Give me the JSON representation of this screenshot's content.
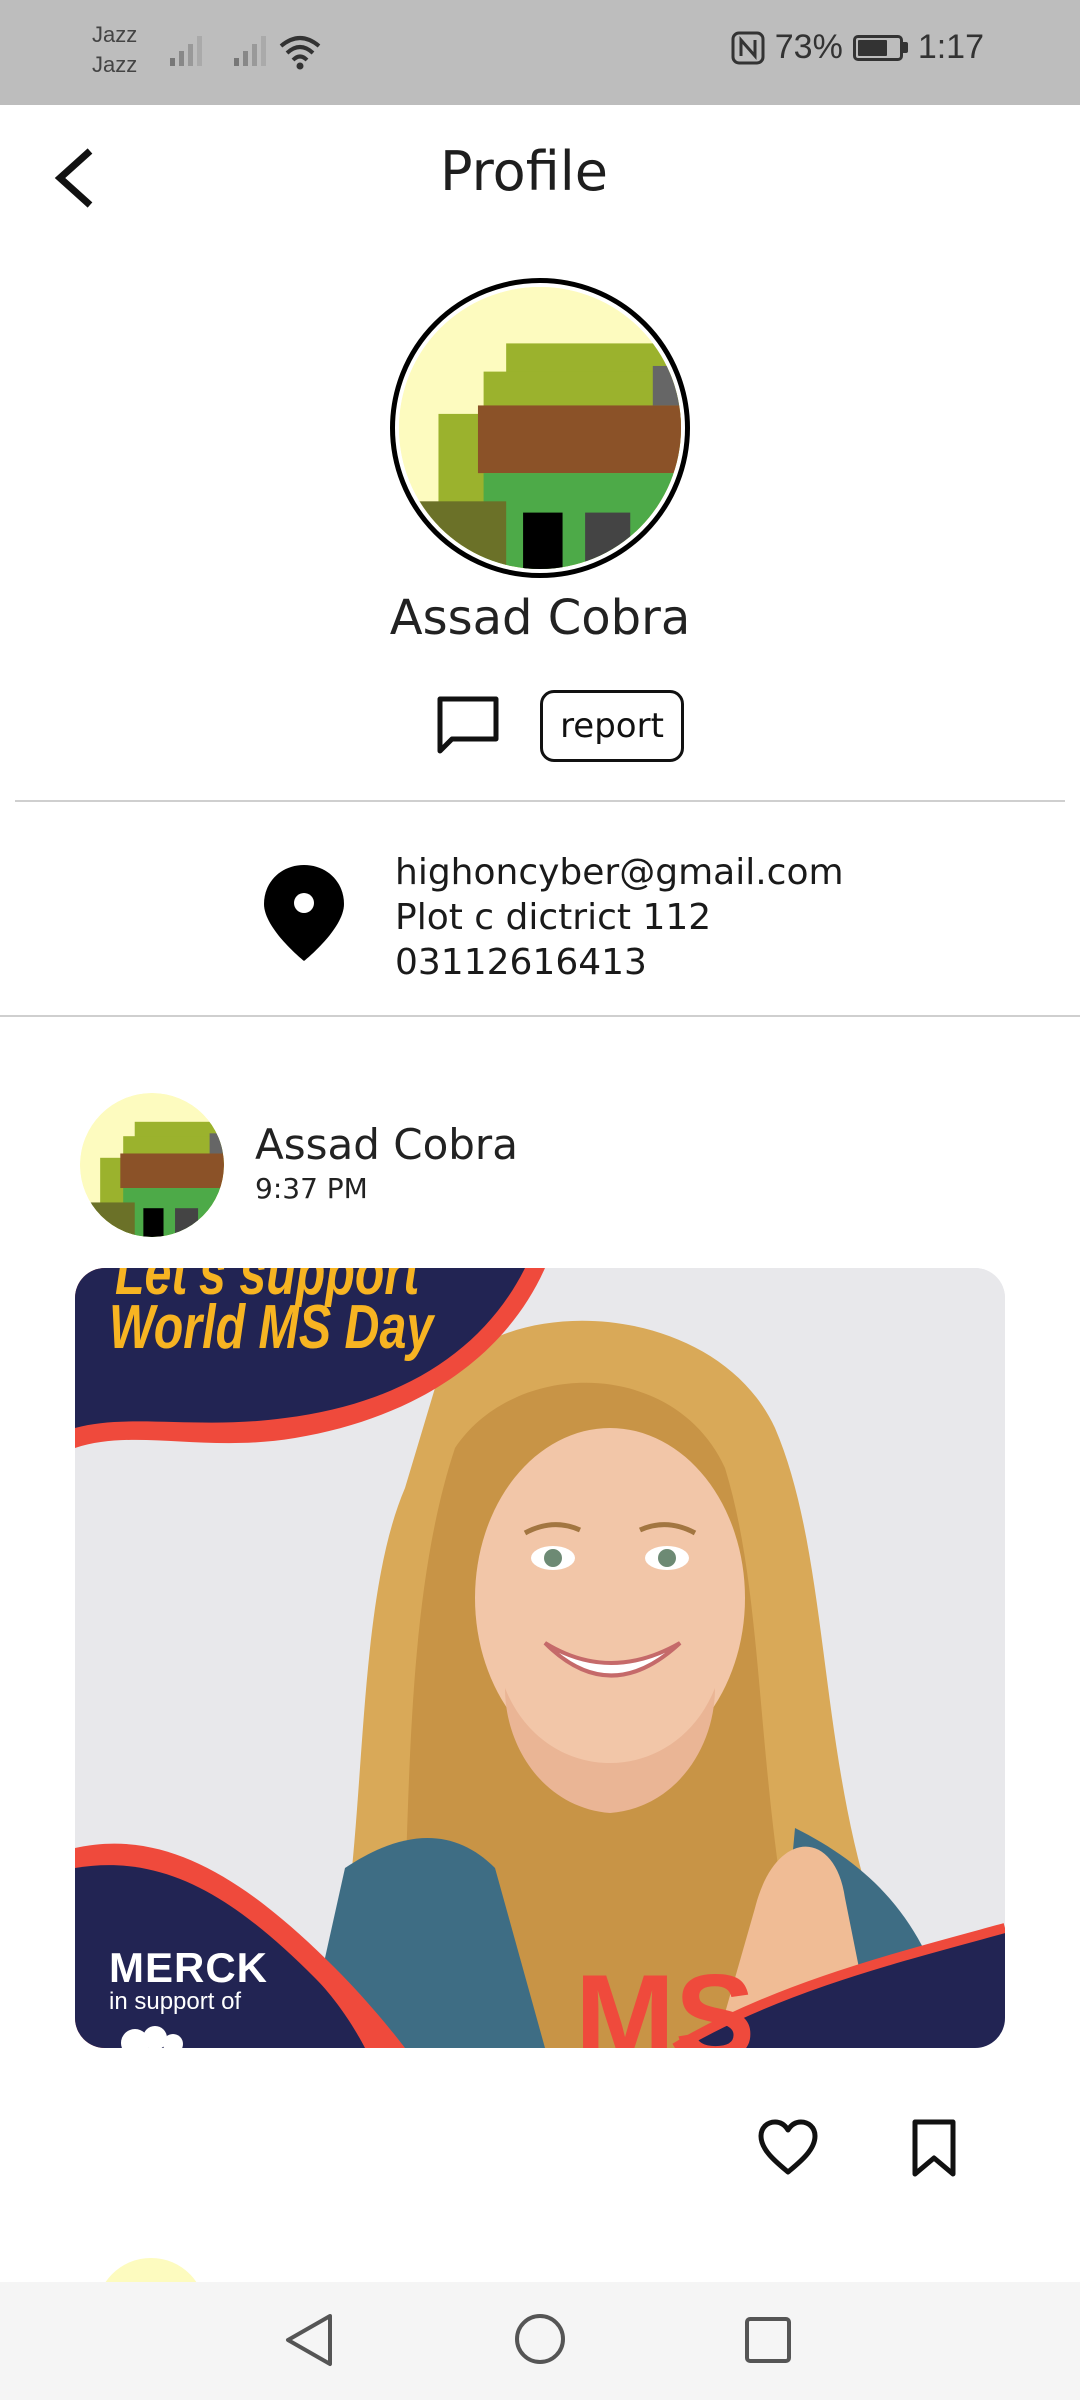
{
  "status_bar": {
    "carrier_1": "Jazz",
    "carrier_2": "Jazz",
    "battery_percent": "73%",
    "battery_level": 0.73,
    "time": "1:17",
    "icons": [
      "signal-icon",
      "signal-icon",
      "wifi-icon",
      "nfc-icon",
      "battery-icon"
    ]
  },
  "header": {
    "title": "Profile",
    "back_icon": "chevron-left-icon"
  },
  "profile": {
    "name": "Assad Cobra",
    "message_icon": "chat-bubble-icon",
    "report_label": "report",
    "contact": {
      "icon": "location-pin-icon",
      "email": "highoncyber@gmail.com",
      "address": "Plot c dictrict 112",
      "phone": "03112616413"
    }
  },
  "post": {
    "author": "Assad Cobra",
    "time": "9:37 PM",
    "image": {
      "banner_top_partial": "Let's support",
      "banner": "World MS Day",
      "logo": "MERCK",
      "support_text": "in support of"
    },
    "like_icon": "heart-icon",
    "save_icon": "bookmark-icon"
  },
  "nav_bar": {
    "back_icon": "triangle-back-icon",
    "home_icon": "circle-home-icon",
    "recents_icon": "square-recents-icon"
  },
  "colors": {
    "status_bar": "#bdbdbd",
    "banner_navy": "#222453",
    "banner_red": "#ef4a3c",
    "banner_yellow": "#f7b422",
    "avatar_yellow": "#fdfbbf"
  }
}
